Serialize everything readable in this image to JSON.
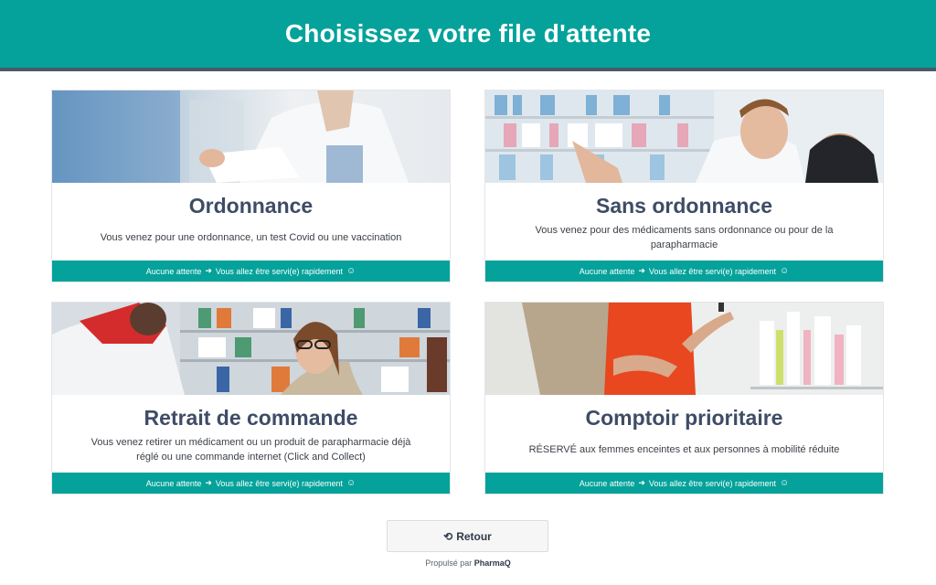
{
  "header": {
    "title": "Choisissez votre file d'attente"
  },
  "cards": [
    {
      "title": "Ordonnance",
      "description": "Vous venez pour une ordonnance, un test Covid ou une vaccination",
      "footer_left": "Aucune attente",
      "footer_right": "Vous allez être servi(e) rapidement"
    },
    {
      "title": "Sans ordonnance",
      "description": "Vous venez pour des médicaments sans ordonnance ou pour de la parapharmacie",
      "footer_left": "Aucune attente",
      "footer_right": "Vous allez être servi(e) rapidement"
    },
    {
      "title": "Retrait de commande",
      "description": "Vous venez retirer un médicament ou un produit de parapharmacie déjà réglé ou une commande internet (Click and Collect)",
      "footer_left": "Aucune attente",
      "footer_right": "Vous allez être servi(e) rapidement"
    },
    {
      "title": "Comptoir prioritaire",
      "description": "RÉSERVÉ aux femmes enceintes et aux personnes à mobilité réduite",
      "footer_left": "Aucune attente",
      "footer_right": "Vous allez être servi(e) rapidement"
    }
  ],
  "retour": {
    "label": "Retour",
    "icon": "undo-icon"
  },
  "credit": {
    "prefix": "Propulsé par",
    "brand": "PharmaQ"
  },
  "colors": {
    "accent": "#04a29b",
    "title": "#3e4c66",
    "header_border": "#4a5a6a"
  }
}
